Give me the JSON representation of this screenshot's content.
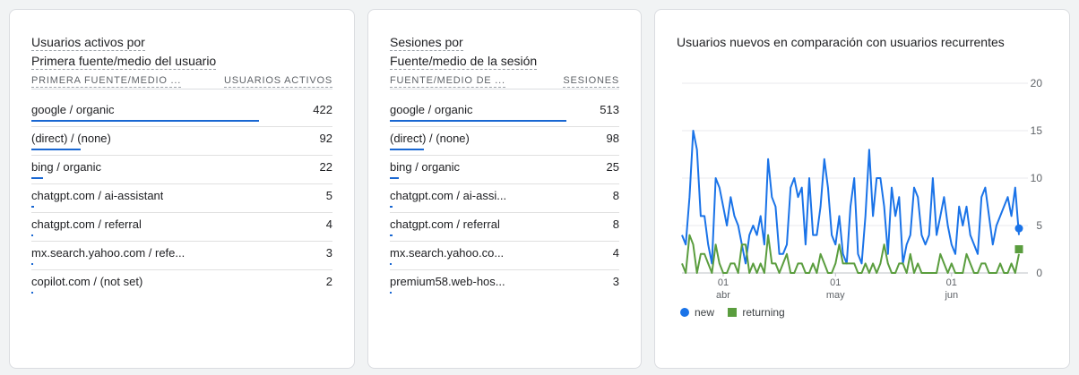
{
  "card1": {
    "title_line1": "Usuarios activos por",
    "title_line2": "Primera fuente/medio del usuario",
    "col1": "PRIMERA FUENTE/MEDIO ...",
    "col2": "USUARIOS ACTIVOS",
    "rows": [
      {
        "label": "google / organic",
        "value": "422",
        "bar": 0.756
      },
      {
        "label": "(direct) / (none)",
        "value": "92",
        "bar": 0.165
      },
      {
        "label": "bing / organic",
        "value": "22",
        "bar": 0.039
      },
      {
        "label": "chatgpt.com / ai-assistant",
        "value": "5",
        "bar": 0.009
      },
      {
        "label": "chatgpt.com / referral",
        "value": "4",
        "bar": 0.007
      },
      {
        "label": "mx.search.yahoo.com / refe...",
        "value": "3",
        "bar": 0.005
      },
      {
        "label": "copilot.com / (not set)",
        "value": "2",
        "bar": 0.004
      }
    ]
  },
  "card2": {
    "title_line1": "Sesiones por",
    "title_line2": "Fuente/medio de la sesión",
    "col1": "FUENTE/MEDIO DE ...",
    "col2": "SESIONES",
    "rows": [
      {
        "label": "google / organic",
        "value": "513",
        "bar": 0.771
      },
      {
        "label": "(direct) / (none)",
        "value": "98",
        "bar": 0.147
      },
      {
        "label": "bing / organic",
        "value": "25",
        "bar": 0.038
      },
      {
        "label": "chatgpt.com / ai-assi...",
        "value": "8",
        "bar": 0.012
      },
      {
        "label": "chatgpt.com / referral",
        "value": "8",
        "bar": 0.012
      },
      {
        "label": "mx.search.yahoo.co...",
        "value": "4",
        "bar": 0.006
      },
      {
        "label": "premium58.web-hos...",
        "value": "3",
        "bar": 0.005
      }
    ]
  },
  "card3": {
    "title": "Usuarios nuevos en comparación con usuarios recurrentes"
  },
  "chart_data": {
    "type": "line",
    "title": "Usuarios nuevos en comparación con usuarios recurrentes",
    "ylim": [
      0,
      20
    ],
    "yticks": [
      "0",
      "5",
      "10",
      "15",
      "20"
    ],
    "xticks": [
      {
        "day": "01",
        "month": "abr",
        "index": 11
      },
      {
        "day": "01",
        "month": "may",
        "index": 41
      },
      {
        "day": "01",
        "month": "jun",
        "index": 72
      }
    ],
    "grid": true,
    "legend_position": "bottom-left",
    "series": [
      {
        "name": "new",
        "color": "#1a73e8",
        "values": [
          4,
          3,
          8,
          15,
          13,
          6,
          6,
          3,
          1,
          10,
          9,
          7,
          5,
          8,
          6,
          5,
          3,
          1,
          4,
          5,
          4,
          6,
          3,
          12,
          8,
          7,
          2,
          2,
          3,
          9,
          10,
          8,
          9,
          3,
          10,
          4,
          4,
          7,
          12,
          9,
          4,
          3,
          6,
          2,
          1,
          7,
          10,
          2,
          1,
          6,
          13,
          6,
          10,
          10,
          7,
          2,
          9,
          6,
          8,
          1,
          3,
          4,
          9,
          8,
          4,
          3,
          4,
          10,
          4,
          6,
          8,
          5,
          3,
          2,
          7,
          5,
          7,
          4,
          3,
          2,
          8,
          9,
          6,
          3,
          5,
          6,
          7,
          8,
          6,
          9,
          4
        ]
      },
      {
        "name": "returning",
        "color": "#5a9d3e",
        "values": [
          1,
          0,
          4,
          3,
          0,
          2,
          2,
          1,
          0,
          3,
          1,
          0,
          0,
          1,
          1,
          0,
          3,
          3,
          0,
          1,
          0,
          1,
          0,
          4,
          1,
          1,
          0,
          1,
          2,
          0,
          0,
          1,
          1,
          0,
          0,
          1,
          0,
          2,
          1,
          0,
          0,
          1,
          3,
          1,
          1,
          1,
          1,
          0,
          0,
          1,
          0,
          1,
          0,
          1,
          3,
          1,
          0,
          0,
          1,
          1,
          0,
          2,
          0,
          1,
          0,
          0,
          0,
          0,
          0,
          2,
          1,
          0,
          1,
          0,
          0,
          0,
          2,
          1,
          0,
          0,
          1,
          1,
          0,
          0,
          0,
          1,
          0,
          0,
          1,
          0,
          2
        ]
      }
    ],
    "endpoints": {
      "new": 4.7,
      "returning": 2.5
    },
    "legend": [
      "new",
      "returning"
    ]
  }
}
